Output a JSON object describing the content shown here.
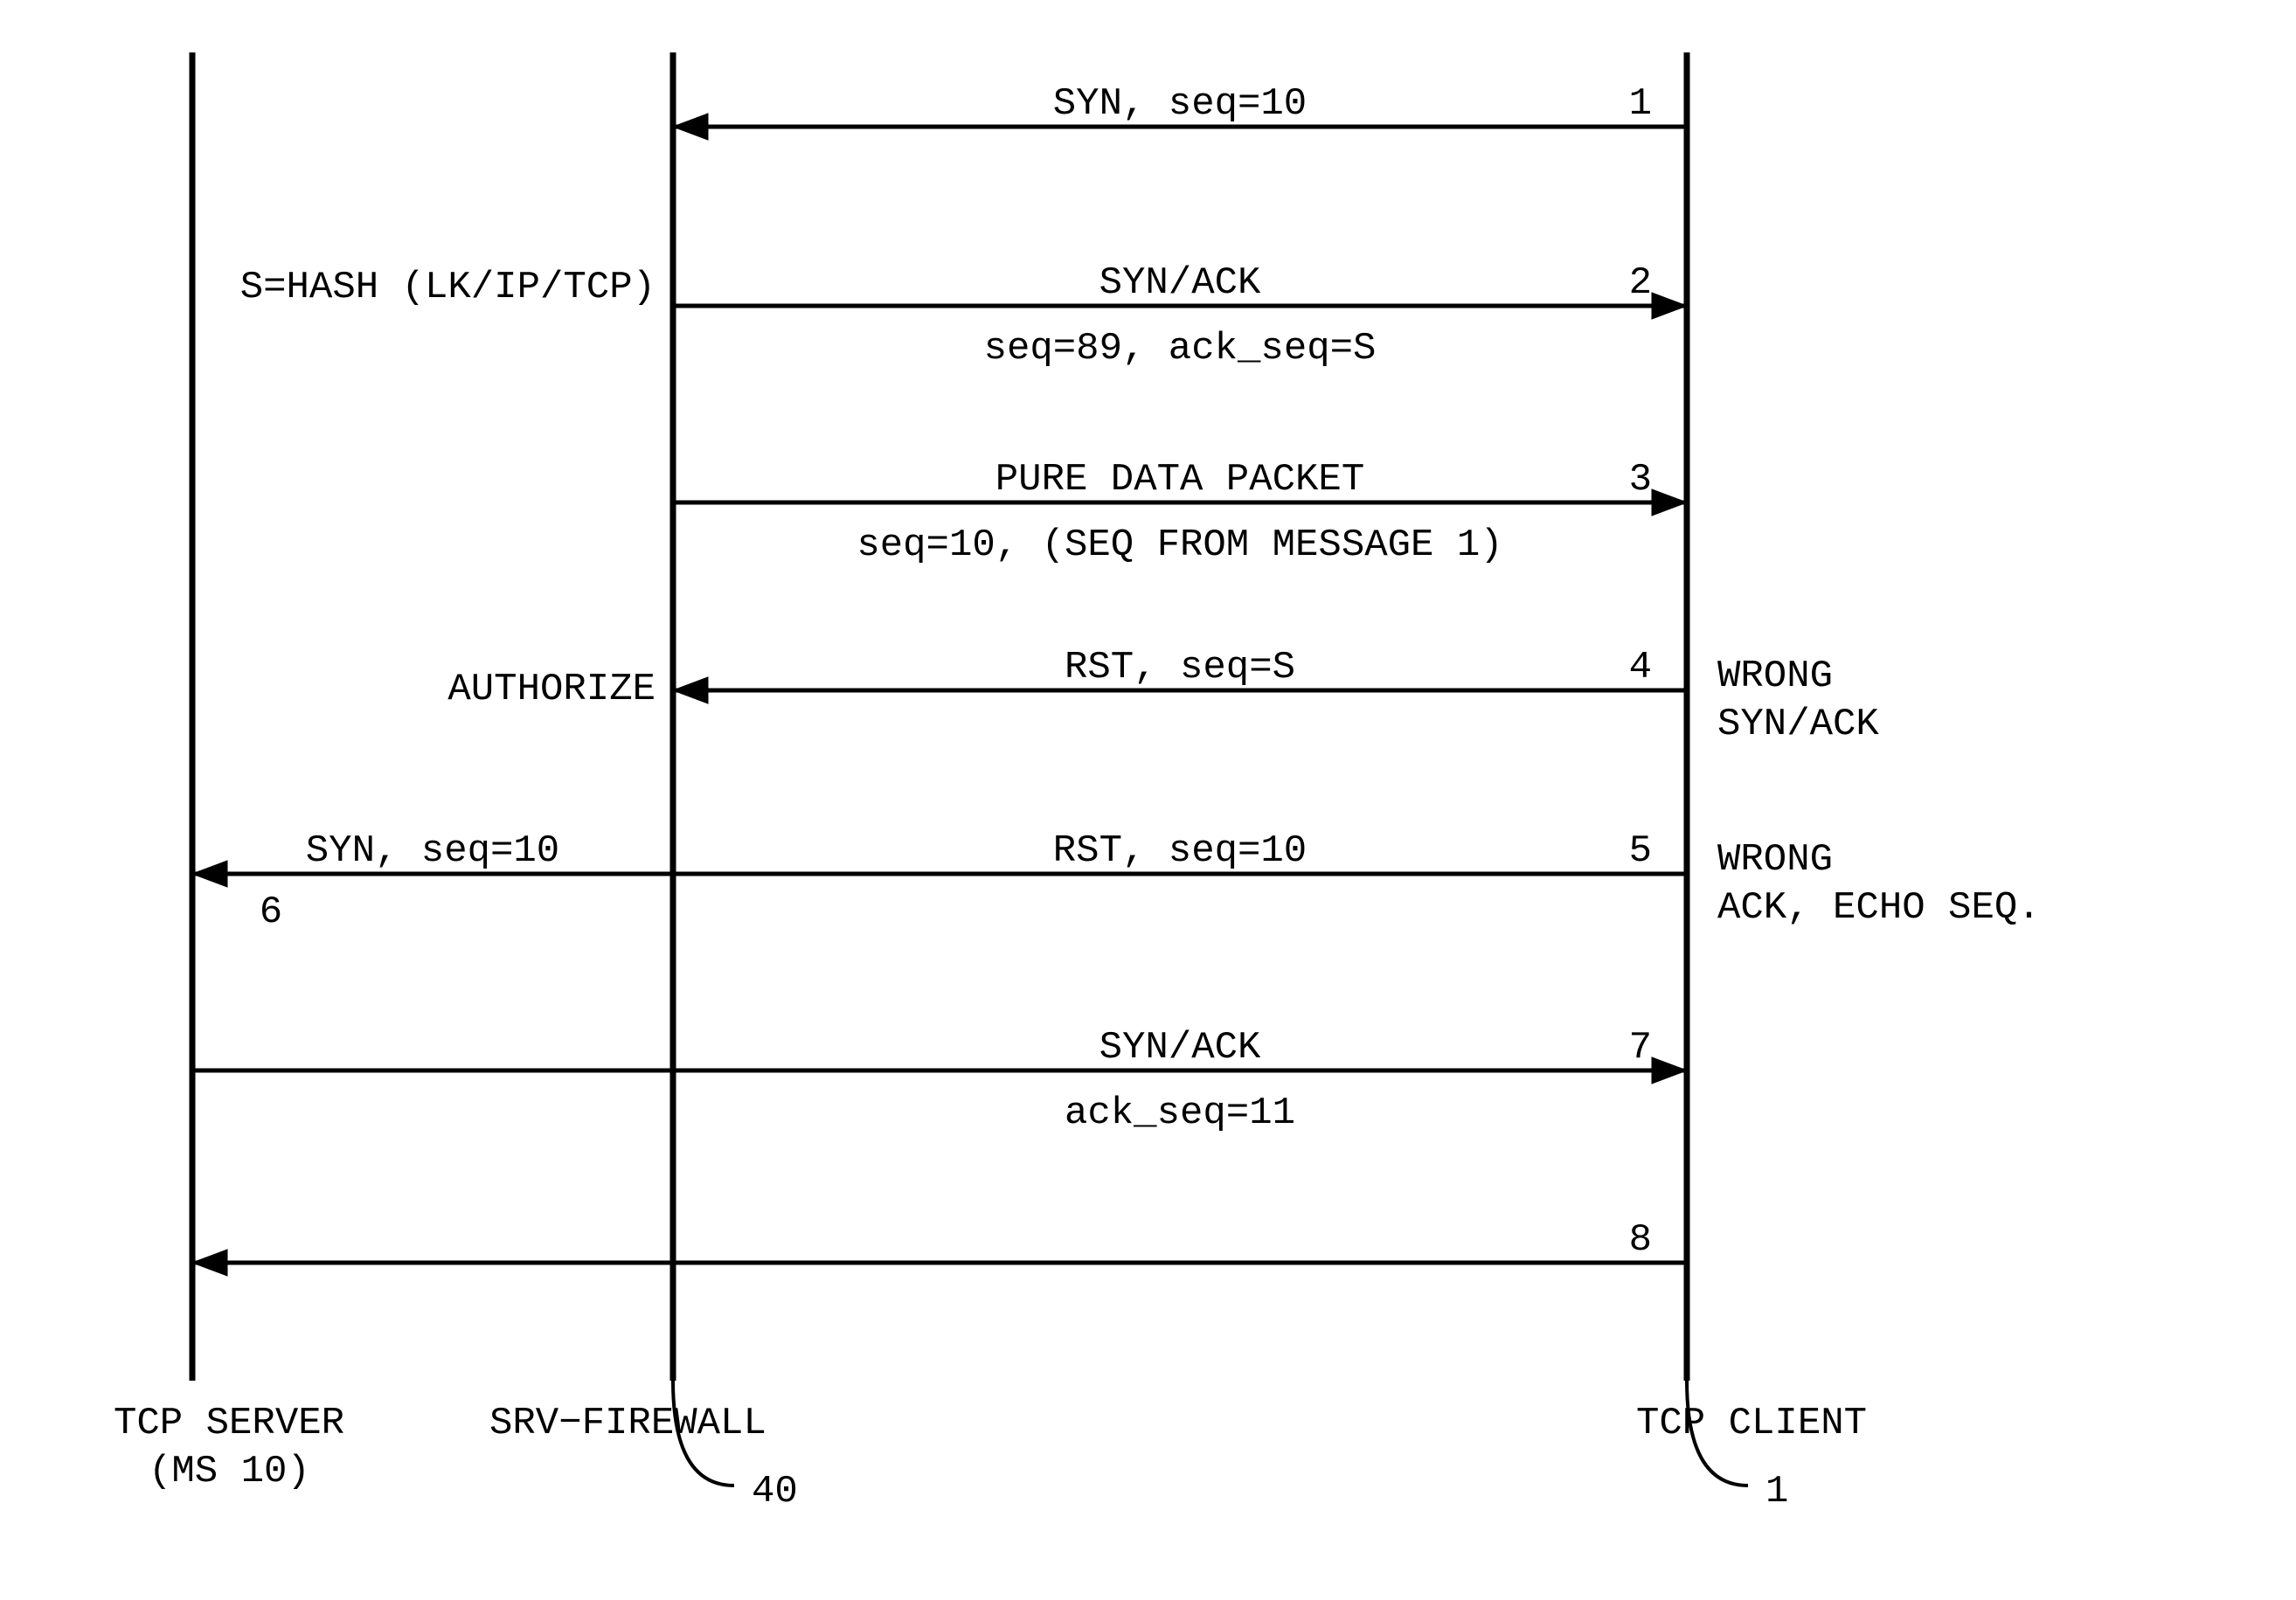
{
  "lifelines": {
    "server": {
      "label_line1": "TCP SERVER",
      "label_line2": "(MS 10)"
    },
    "firewall": {
      "label": "SRV−FIREWALL",
      "callout_number": "40"
    },
    "client": {
      "label": "TCP CLIENT",
      "callout_number": "1"
    }
  },
  "messages": {
    "m1": {
      "above": "SYN, seq=10",
      "num": "1"
    },
    "hash_note": "S=HASH (LK/IP/TCP)",
    "m2": {
      "above": "SYN/ACK",
      "below": "seq=89, ack_seq=S",
      "num": "2"
    },
    "m3": {
      "above": "PURE DATA PACKET",
      "below": "seq=10, (SEQ FROM MESSAGE 1)",
      "num": "3"
    },
    "authorize_note": "AUTHORIZE",
    "m4": {
      "above": "RST, seq=S",
      "num": "4",
      "right1": "WRONG",
      "right2": "SYN/ACK"
    },
    "m5": {
      "above": "RST, seq=10",
      "num": "5",
      "right1": "WRONG",
      "right2": "ACK, ECHO SEQ."
    },
    "m6": {
      "above": "SYN, seq=10",
      "num": "6"
    },
    "m7": {
      "above": "SYN/ACK",
      "below": "ack_seq=11",
      "num": "7"
    },
    "m8": {
      "num": "8"
    }
  }
}
